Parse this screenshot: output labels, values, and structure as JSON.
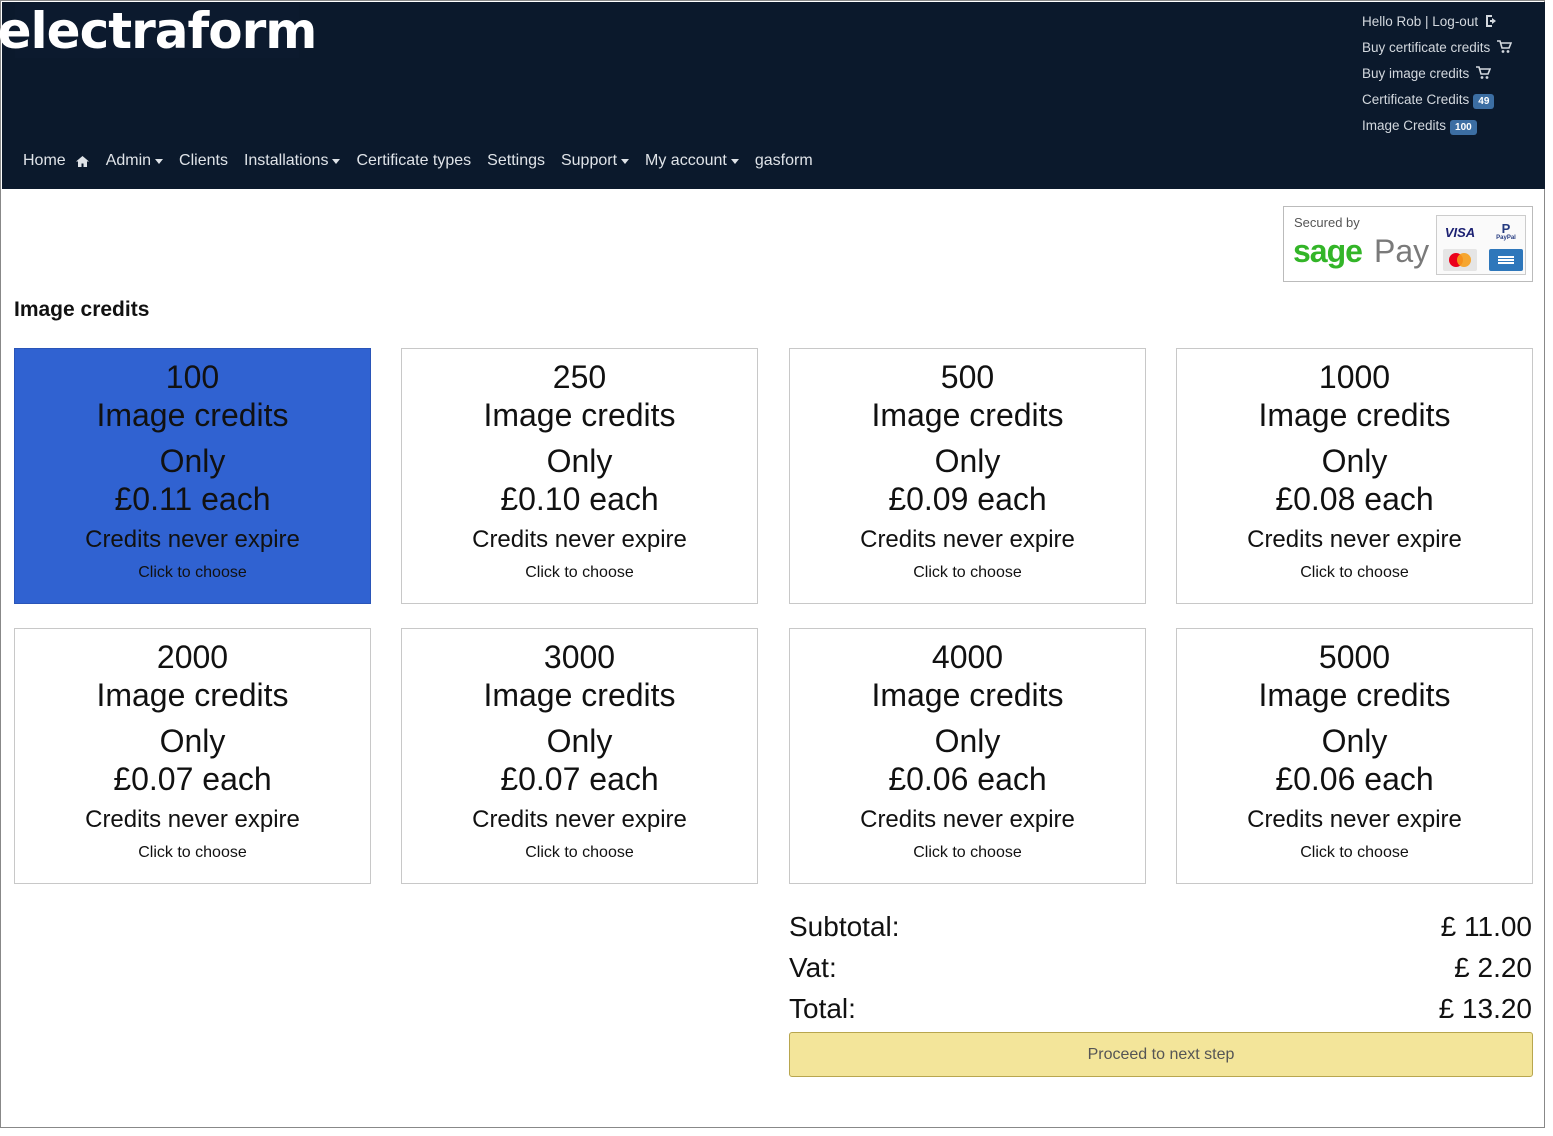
{
  "brand": {
    "logo_text": "electraform"
  },
  "top_links": {
    "greeting": "Hello Rob | Log-out",
    "buy_certificate_credits": "Buy certificate credits",
    "buy_image_credits": "Buy image credits",
    "certificate_credits_label": "Certificate Credits",
    "certificate_credits_count": "49",
    "image_credits_label": "Image Credits",
    "image_credits_count": "100"
  },
  "nav": {
    "home": "Home",
    "admin": "Admin",
    "clients": "Clients",
    "installations": "Installations",
    "certificate_types": "Certificate types",
    "settings": "Settings",
    "support": "Support",
    "my_account": "My account",
    "gasform": "gasform"
  },
  "payment_badge": {
    "secured_by": "Secured by",
    "sage": "sage",
    "pay": "Pay",
    "visa": "VISA",
    "paypal": "PayPal"
  },
  "section_title": "Image credits",
  "packs": [
    {
      "qty": "100",
      "label": "Image credits",
      "only": "Only",
      "price": "£0.11 each",
      "never": "Credits never expire",
      "click": "Click to choose",
      "selected": true
    },
    {
      "qty": "250",
      "label": "Image credits",
      "only": "Only",
      "price": "£0.10 each",
      "never": "Credits never expire",
      "click": "Click to choose",
      "selected": false
    },
    {
      "qty": "500",
      "label": "Image credits",
      "only": "Only",
      "price": "£0.09 each",
      "never": "Credits never expire",
      "click": "Click to choose",
      "selected": false
    },
    {
      "qty": "1000",
      "label": "Image credits",
      "only": "Only",
      "price": "£0.08 each",
      "never": "Credits never expire",
      "click": "Click to choose",
      "selected": false
    },
    {
      "qty": "2000",
      "label": "Image credits",
      "only": "Only",
      "price": "£0.07 each",
      "never": "Credits never expire",
      "click": "Click to choose",
      "selected": false
    },
    {
      "qty": "3000",
      "label": "Image credits",
      "only": "Only",
      "price": "£0.07 each",
      "never": "Credits never expire",
      "click": "Click to choose",
      "selected": false
    },
    {
      "qty": "4000",
      "label": "Image credits",
      "only": "Only",
      "price": "£0.06 each",
      "never": "Credits never expire",
      "click": "Click to choose",
      "selected": false
    },
    {
      "qty": "5000",
      "label": "Image credits",
      "only": "Only",
      "price": "£0.06 each",
      "never": "Credits never expire",
      "click": "Click to choose",
      "selected": false
    }
  ],
  "totals": {
    "subtotal_label": "Subtotal:",
    "subtotal_value": "£ 11.00",
    "vat_label": "Vat:",
    "vat_value": "£ 2.20",
    "total_label": "Total:",
    "total_value": "£ 13.20"
  },
  "proceed_label": "Proceed to next step",
  "colors": {
    "header_bg": "#0b192c",
    "selected_pack": "#3062d1",
    "proceed_bg": "#f3e59a",
    "badge_bg": "#3c6ea3",
    "sage_green": "#33b528"
  }
}
